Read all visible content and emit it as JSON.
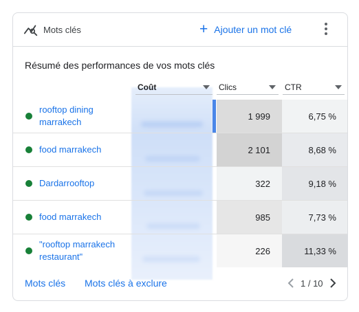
{
  "header": {
    "title": "Mots clés",
    "add_label": "Ajouter un mot clé"
  },
  "subtitle": "Résumé des performances de vos mots clés",
  "columns": {
    "cout": "Coût",
    "clics": "Clics",
    "ctr": "CTR"
  },
  "rows": [
    {
      "keyword": "rooftop dining marrakech",
      "clics": "1 999",
      "ctr": "6,75 %",
      "shade": "#dcdcdc",
      "ctr_shade": "#f1f3f4"
    },
    {
      "keyword": "food marrakech",
      "clics": "2 101",
      "ctr": "8,68 %",
      "shade": "#d3d3d3",
      "ctr_shade": "#e8eaed"
    },
    {
      "keyword": "Dardarrooftop",
      "clics": "322",
      "ctr": "9,18 %",
      "shade": "#f1f3f4",
      "ctr_shade": "#e3e5e8"
    },
    {
      "keyword": "food marrakech",
      "clics": "985",
      "ctr": "7,73 %",
      "shade": "#e6e6e6",
      "ctr_shade": "#eceef0"
    },
    {
      "keyword": "\"rooftop marrakech restaurant\"",
      "clics": "226",
      "ctr": "11,33 %",
      "shade": "#f6f6f6",
      "ctr_shade": "#d9dbde"
    }
  ],
  "footer": {
    "link_keywords": "Mots clés",
    "link_excluded": "Mots clés à exclure",
    "page": "1 / 10"
  },
  "colors": {
    "accent": "#1a73e8",
    "status_enabled": "#188038"
  },
  "icons": {
    "header": "keyword-chart-icon",
    "more": "more-vert-icon",
    "prev": "chevron-left-icon",
    "next": "chevron-right-icon"
  }
}
